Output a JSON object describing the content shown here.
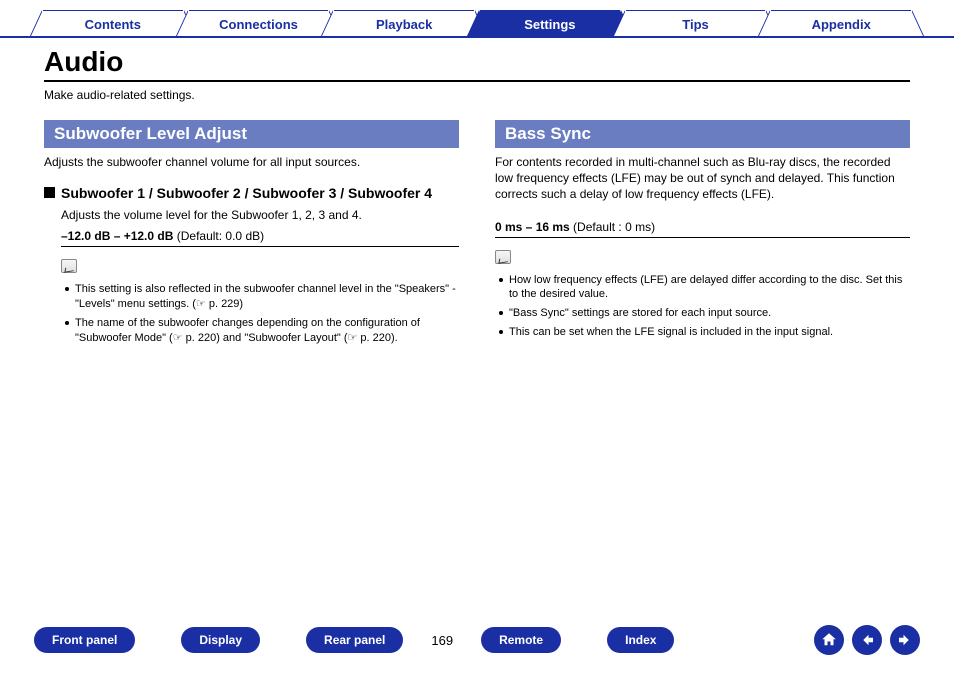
{
  "tabs": {
    "items": [
      "Contents",
      "Connections",
      "Playback",
      "Settings",
      "Tips",
      "Appendix"
    ],
    "activeIndex": 3
  },
  "page": {
    "title": "Audio",
    "intro": "Make audio-related settings.",
    "number": "169"
  },
  "left": {
    "header": "Subwoofer Level Adjust",
    "desc": "Adjusts the subwoofer channel volume for all input sources.",
    "sub_title": "Subwoofer 1 / Subwoofer 2 / Subwoofer 3 / Subwoofer 4",
    "sub_desc": "Adjusts the volume level for the Subwoofer 1, 2, 3 and 4.",
    "range_bold": "–12.0 dB – +12.0 dB",
    "range_rest": " (Default: 0.0 dB)",
    "notes": [
      "This setting is also reflected in the subwoofer channel level in the \"Speakers\" - \"Levels\" menu settings. (☞ p. 229)",
      "The name of the subwoofer changes depending on the configuration of \"Subwoofer Mode\" (☞ p. 220) and \"Subwoofer Layout\" (☞ p. 220)."
    ]
  },
  "right": {
    "header": "Bass Sync",
    "desc": "For contents recorded in multi-channel such as Blu-ray discs, the recorded low frequency effects (LFE) may be out of synch and delayed. This function corrects such a delay of low frequency effects (LFE).",
    "range_bold": "0 ms – 16 ms",
    "range_rest": " (Default : 0 ms)",
    "notes": [
      "How low frequency effects (LFE) are delayed differ according to the disc. Set this to the desired value.",
      "\"Bass Sync\" settings are stored for each input source.",
      "This can be set when the LFE signal is included in the input signal."
    ]
  },
  "bottom": {
    "buttons": [
      "Front panel",
      "Display",
      "Rear panel"
    ],
    "buttons2": [
      "Remote",
      "Index"
    ]
  }
}
